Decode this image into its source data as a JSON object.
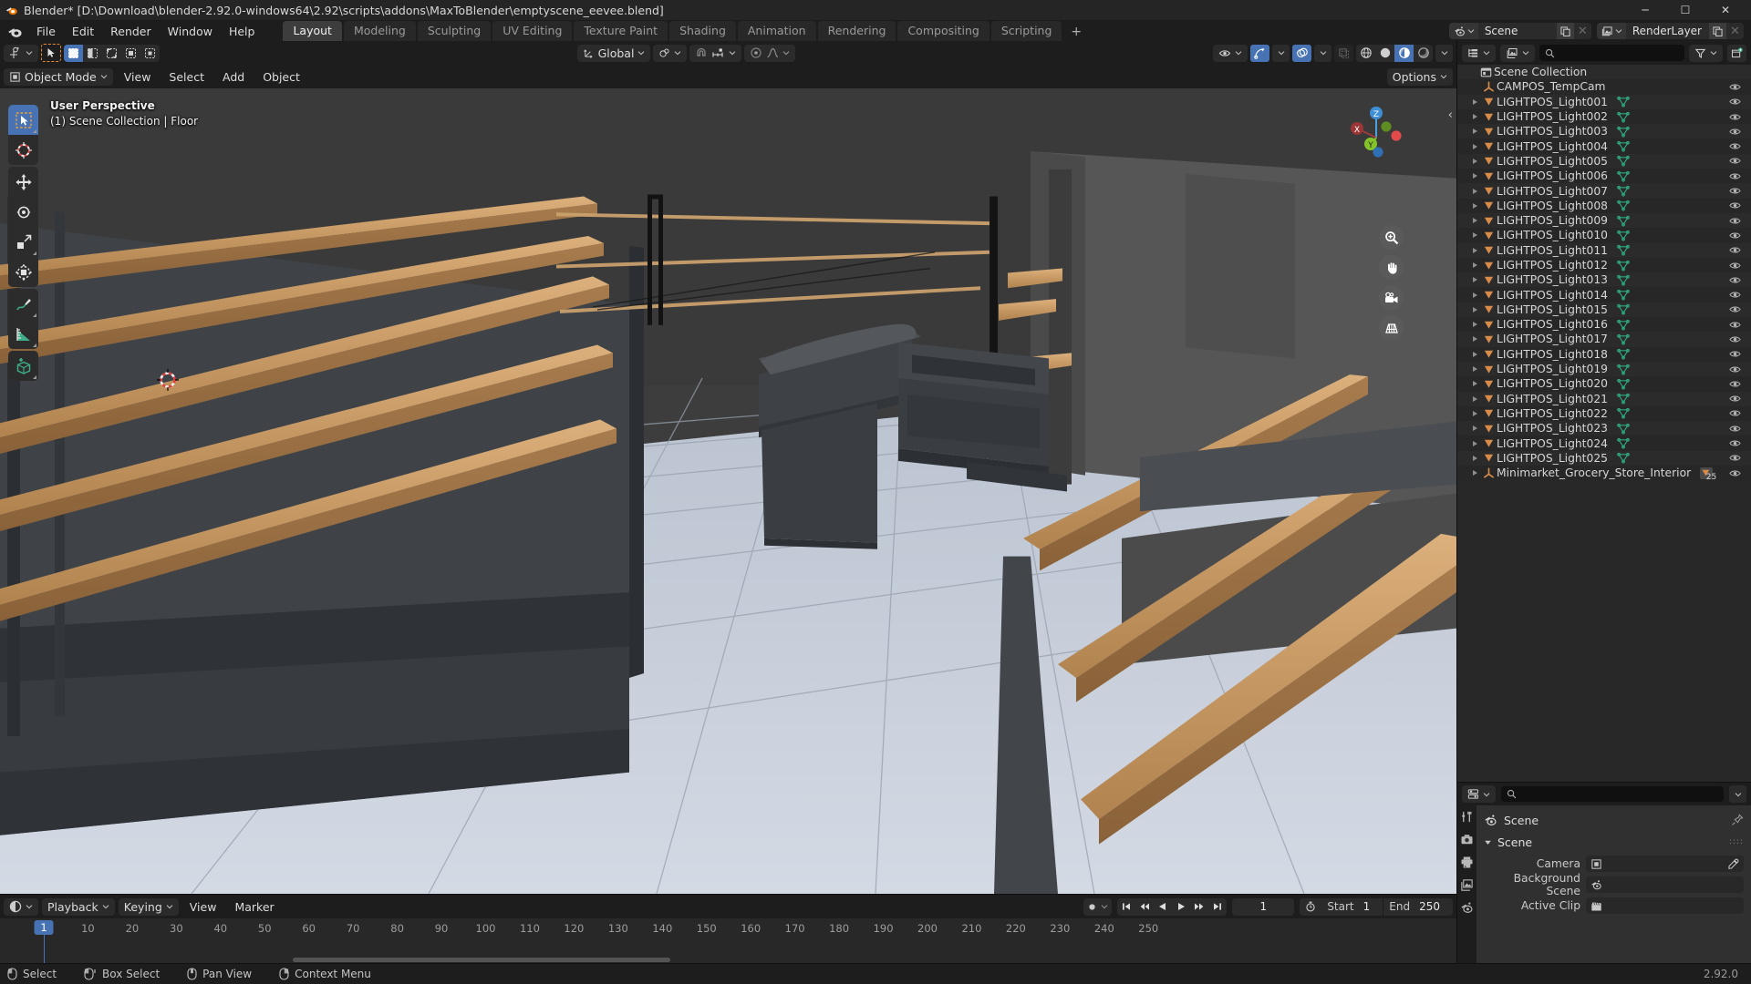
{
  "window": {
    "title": "Blender* [D:\\Download\\blender-2.92.0-windows64\\2.92\\scripts\\addons\\MaxToBlender\\emptyscene_eevee.blend]",
    "icon": "blender-logo-icon",
    "minimize": "─",
    "maximize": "☐",
    "close": "✕"
  },
  "topbar": {
    "menus": [
      "File",
      "Edit",
      "Render",
      "Window",
      "Help"
    ],
    "workspaces": [
      {
        "label": "Layout",
        "active": true
      },
      {
        "label": "Modeling",
        "active": false
      },
      {
        "label": "Sculpting",
        "active": false
      },
      {
        "label": "UV Editing",
        "active": false
      },
      {
        "label": "Texture Paint",
        "active": false
      },
      {
        "label": "Shading",
        "active": false
      },
      {
        "label": "Animation",
        "active": false
      },
      {
        "label": "Rendering",
        "active": false
      },
      {
        "label": "Compositing",
        "active": false
      },
      {
        "label": "Scripting",
        "active": false
      }
    ],
    "add_workspace": "+",
    "scene": {
      "name": "Scene",
      "icon": "scene-icon",
      "new_label": "new-scene-icon",
      "unlink_label": "✕"
    },
    "view_layer": {
      "name": "RenderLayer",
      "icon": "view-layer-icon",
      "new_label": "new-layer-icon",
      "unlink_label": "✕"
    }
  },
  "viewport": {
    "editor_type": "editor-type-3dview-icon",
    "select_mode_tool": "tweak-tool-icon",
    "select_modes": [
      "set",
      "extend",
      "subtract",
      "invert",
      "intersect"
    ],
    "mode": "Object Mode",
    "menus": [
      "View",
      "Select",
      "Add",
      "Object"
    ],
    "transform_orientation": "Global",
    "pivot": "pivot-icon",
    "snap": "snap-magnet-icon",
    "proportional": "proportional-edit-icon",
    "falloff": "falloff-icon",
    "options_label": "Options",
    "overlay_line1": "User Perspective",
    "overlay_line2": "(1) Scene Collection | Floor",
    "shading_modes": [
      "wireframe",
      "solid",
      "material-preview",
      "rendered"
    ],
    "shading_active": 2,
    "toolbar": [
      {
        "name": "tweak-tool-icon",
        "active": true
      },
      {
        "name": "cursor-tool-icon",
        "active": false
      },
      {
        "name": "move-tool-icon",
        "active": false
      },
      {
        "name": "rotate-tool-icon",
        "active": false
      },
      {
        "name": "scale-tool-icon",
        "active": false
      },
      {
        "name": "transform-tool-icon",
        "active": false
      },
      {
        "name": "annotate-tool-icon",
        "active": false
      },
      {
        "name": "measure-tool-icon",
        "active": false
      },
      {
        "name": "add-cube-tool-icon",
        "active": false
      }
    ],
    "gizmo_axes": [
      "Z",
      "Y",
      "X"
    ],
    "nav_buttons": [
      "zoom-icon",
      "pan-hand-icon",
      "camera-view-icon",
      "toggle-perspective-icon"
    ],
    "sidebar_toggle": "‹"
  },
  "timeline": {
    "editor_type": "editor-type-timeline-icon",
    "menus": [
      {
        "label": "Playback",
        "dropdown": true
      },
      {
        "label": "Keying",
        "dropdown": true
      },
      {
        "label": "View",
        "dropdown": false
      },
      {
        "label": "Marker",
        "dropdown": false
      }
    ],
    "auto_key": "record-icon",
    "transport": [
      "jump-start-icon",
      "prev-keyframe-icon",
      "play-reverse-icon",
      "play-icon",
      "next-keyframe-icon",
      "jump-end-icon"
    ],
    "current_frame": "1",
    "start_label": "Start",
    "start_value": "1",
    "end_label": "End",
    "end_value": "250",
    "ticks": [
      "10",
      "20",
      "30",
      "40",
      "50",
      "60",
      "70",
      "80",
      "90",
      "100",
      "110",
      "120",
      "130",
      "140",
      "150",
      "160",
      "170",
      "180",
      "190",
      "200",
      "210",
      "220",
      "230",
      "240",
      "250"
    ],
    "playhead_label": "1"
  },
  "outliner": {
    "editor_type": "editor-type-outliner-icon",
    "display_mode": "view-layer-icon",
    "search_placeholder": "",
    "filter_icon": "filter-funnel-icon",
    "new_collection_icon": "new-collection-icon",
    "root": {
      "label": "Scene Collection",
      "icon": "collection-icon"
    },
    "rows": [
      {
        "label": "CAMPOS_TempCam",
        "icon": "empty-axis-icon",
        "disclosure": false,
        "data": null,
        "visible": true
      },
      {
        "label": "LIGHTPOS_Light001",
        "icon": "light-icon",
        "disclosure": true,
        "data": "mesh-data-icon",
        "visible": true
      },
      {
        "label": "LIGHTPOS_Light002",
        "icon": "light-icon",
        "disclosure": true,
        "data": "mesh-data-icon",
        "visible": true
      },
      {
        "label": "LIGHTPOS_Light003",
        "icon": "light-icon",
        "disclosure": true,
        "data": "mesh-data-icon",
        "visible": true
      },
      {
        "label": "LIGHTPOS_Light004",
        "icon": "light-icon",
        "disclosure": true,
        "data": "mesh-data-icon",
        "visible": true
      },
      {
        "label": "LIGHTPOS_Light005",
        "icon": "light-icon",
        "disclosure": true,
        "data": "mesh-data-icon",
        "visible": true
      },
      {
        "label": "LIGHTPOS_Light006",
        "icon": "light-icon",
        "disclosure": true,
        "data": "mesh-data-icon",
        "visible": true
      },
      {
        "label": "LIGHTPOS_Light007",
        "icon": "light-icon",
        "disclosure": true,
        "data": "mesh-data-icon",
        "visible": true
      },
      {
        "label": "LIGHTPOS_Light008",
        "icon": "light-icon",
        "disclosure": true,
        "data": "mesh-data-icon",
        "visible": true
      },
      {
        "label": "LIGHTPOS_Light009",
        "icon": "light-icon",
        "disclosure": true,
        "data": "mesh-data-icon",
        "visible": true
      },
      {
        "label": "LIGHTPOS_Light010",
        "icon": "light-icon",
        "disclosure": true,
        "data": "mesh-data-icon",
        "visible": true
      },
      {
        "label": "LIGHTPOS_Light011",
        "icon": "light-icon",
        "disclosure": true,
        "data": "mesh-data-icon",
        "visible": true
      },
      {
        "label": "LIGHTPOS_Light012",
        "icon": "light-icon",
        "disclosure": true,
        "data": "mesh-data-icon",
        "visible": true
      },
      {
        "label": "LIGHTPOS_Light013",
        "icon": "light-icon",
        "disclosure": true,
        "data": "mesh-data-icon",
        "visible": true
      },
      {
        "label": "LIGHTPOS_Light014",
        "icon": "light-icon",
        "disclosure": true,
        "data": "mesh-data-icon",
        "visible": true
      },
      {
        "label": "LIGHTPOS_Light015",
        "icon": "light-icon",
        "disclosure": true,
        "data": "mesh-data-icon",
        "visible": true
      },
      {
        "label": "LIGHTPOS_Light016",
        "icon": "light-icon",
        "disclosure": true,
        "data": "mesh-data-icon",
        "visible": true
      },
      {
        "label": "LIGHTPOS_Light017",
        "icon": "light-icon",
        "disclosure": true,
        "data": "mesh-data-icon",
        "visible": true
      },
      {
        "label": "LIGHTPOS_Light018",
        "icon": "light-icon",
        "disclosure": true,
        "data": "mesh-data-icon",
        "visible": true
      },
      {
        "label": "LIGHTPOS_Light019",
        "icon": "light-icon",
        "disclosure": true,
        "data": "mesh-data-icon",
        "visible": true
      },
      {
        "label": "LIGHTPOS_Light020",
        "icon": "light-icon",
        "disclosure": true,
        "data": "mesh-data-icon",
        "visible": true
      },
      {
        "label": "LIGHTPOS_Light021",
        "icon": "light-icon",
        "disclosure": true,
        "data": "mesh-data-icon",
        "visible": true
      },
      {
        "label": "LIGHTPOS_Light022",
        "icon": "light-icon",
        "disclosure": true,
        "data": "mesh-data-icon",
        "visible": true
      },
      {
        "label": "LIGHTPOS_Light023",
        "icon": "light-icon",
        "disclosure": true,
        "data": "mesh-data-icon",
        "visible": true
      },
      {
        "label": "LIGHTPOS_Light024",
        "icon": "light-icon",
        "disclosure": true,
        "data": "mesh-data-icon",
        "visible": true
      },
      {
        "label": "LIGHTPOS_Light025",
        "icon": "light-icon",
        "disclosure": true,
        "data": "mesh-data-icon",
        "visible": true
      },
      {
        "label": "Minimarket_Grocery_Store_Interior",
        "icon": "empty-axis-icon",
        "disclosure": true,
        "data": "light-group-icon",
        "data_count": "25",
        "visible": true
      }
    ]
  },
  "properties": {
    "editor_type": "editor-type-properties-icon",
    "search_placeholder": "",
    "tabs": [
      "tool-icon",
      "render-icon",
      "output-icon",
      "view-layer-icon",
      "scene-icon"
    ],
    "breadcrumb": "Scene",
    "breadcrumb_icon": "scene-icon",
    "pin_icon": "pin-icon",
    "panel_title": "Scene",
    "rows": [
      {
        "label": "Camera",
        "value": "",
        "icon": "camera-object-icon",
        "eyedropper": true
      },
      {
        "label": "Background Scene",
        "value": "",
        "icon": "scene-icon",
        "eyedropper": false
      },
      {
        "label": "Active Clip",
        "value": "",
        "icon": "movie-clip-icon",
        "eyedropper": false
      }
    ]
  },
  "statusbar": {
    "items": [
      {
        "icon": "mouse-left-icon",
        "label": "Select"
      },
      {
        "icon": "mouse-left-drag-icon",
        "label": "Box Select"
      },
      {
        "icon": "mouse-middle-icon",
        "label": "Pan View"
      },
      {
        "icon": "mouse-right-icon",
        "label": "Context Menu"
      }
    ],
    "version": "2.92.0"
  },
  "colors": {
    "accent": "#4772b3",
    "orange": "#e8892b",
    "mesh_green": "#3fae8a",
    "bg_dark": "#1d1d1d",
    "bg_panel": "#303030",
    "viewport_floor": "#c6cbd6"
  }
}
